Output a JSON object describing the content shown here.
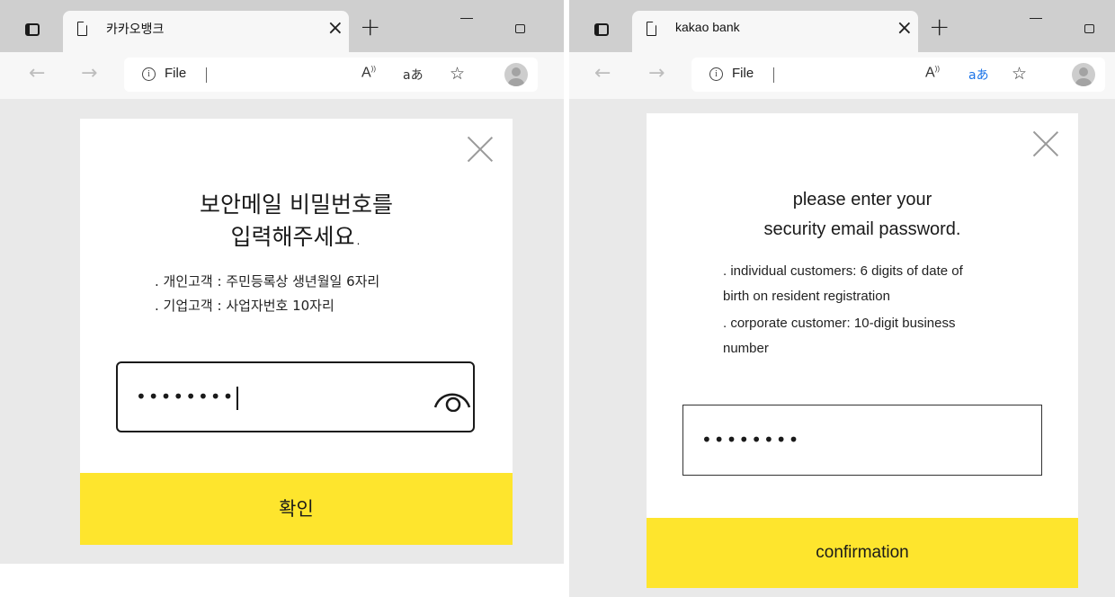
{
  "window_left": {
    "tab_title": "카카오뱅크",
    "address_label": "File",
    "dialog": {
      "heading_line1": "보안메일 비밀번호를",
      "heading_line2": "입력해주세요.",
      "info_line1": ". 개인고객 : 주민등록상 생년월일 6자리",
      "info_line2": ". 기업고객 : 사업자번호 10자리",
      "password_value": "••••••••",
      "confirm_label": "확인"
    }
  },
  "window_right": {
    "tab_title": "kakao bank",
    "address_label": "File",
    "dialog": {
      "heading_line1": "please enter your",
      "heading_line2": "security email password.",
      "info_line1": ". individual customers: 6 digits of date of",
      "info_line2": "birth on resident registration",
      "info_line3": ". corporate customer: 10-digit business",
      "info_line4": "number",
      "password_value": "••••••••",
      "confirm_label": "confirmation"
    }
  },
  "browser": {
    "tab_close_glyph": "×",
    "new_tab_glyph": "+",
    "back_glyph": "←",
    "forward_glyph": "→",
    "info_glyph": "i",
    "read_aloud_glyph": "A",
    "translate_glyph": "aあ",
    "favorite_glyph": "☆"
  },
  "colors": {
    "confirm_yellow": "#fee52d",
    "titlebar_gray": "#cfcfcf",
    "content_gray": "#e9e9e9",
    "translate_active_blue": "#1a73e8"
  }
}
